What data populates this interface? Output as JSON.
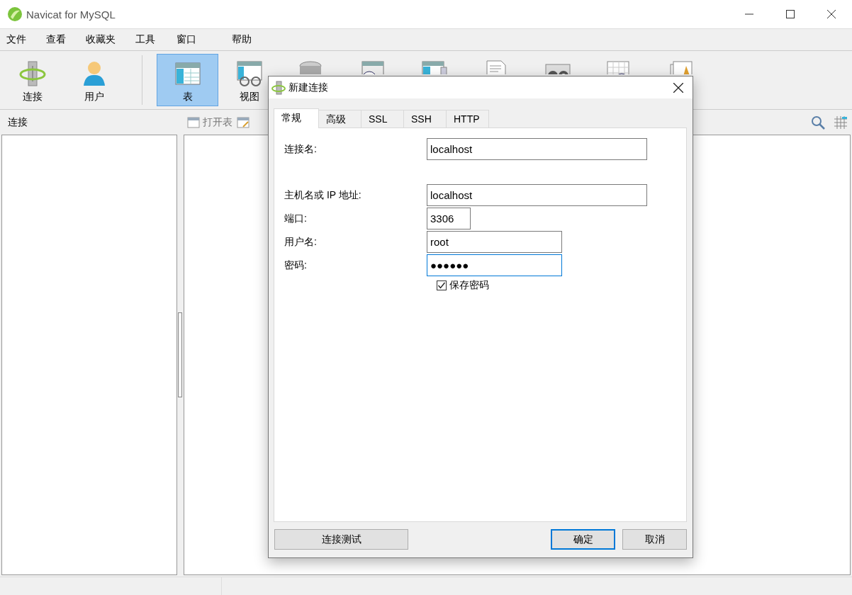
{
  "window": {
    "title": "Navicat for MySQL"
  },
  "menu": [
    "文件",
    "查看",
    "收藏夹",
    "工具",
    "窗口",
    "帮助"
  ],
  "toolbar": [
    {
      "label": "连接",
      "selected": false
    },
    {
      "label": "用户",
      "selected": false
    },
    {
      "label": "表",
      "selected": true
    },
    {
      "label": "视图",
      "selected": false
    },
    {
      "selected": false
    },
    {
      "selected": false
    },
    {
      "selected": false
    },
    {
      "selected": false
    },
    {
      "selected": false
    },
    {
      "selected": false
    },
    {
      "selected": false
    }
  ],
  "sidebar": {
    "title": "连接"
  },
  "object_toolbar": [
    "打开表"
  ],
  "dialog": {
    "title": "新建连接",
    "tabs": [
      {
        "label": "常规",
        "selected": true
      },
      {
        "label": "高级",
        "selected": false
      },
      {
        "label": "SSL",
        "selected": false
      },
      {
        "label": "SSH",
        "selected": false
      },
      {
        "label": "HTTP",
        "selected": false
      }
    ],
    "fields": [
      {
        "label": "连接名:",
        "value": "localhost",
        "focused": false
      },
      {
        "label": "主机名或 IP 地址:",
        "value": "localhost",
        "focused": false
      },
      {
        "label": "端口:",
        "value": "3306",
        "focused": false
      },
      {
        "label": "用户名:",
        "value": "root",
        "focused": false
      },
      {
        "label": "密码:",
        "value": "●●●●●●",
        "focused": true
      }
    ],
    "save_password": {
      "label": "保存密码",
      "checked": true
    },
    "buttons": [
      {
        "label": "连接测试",
        "default": false
      },
      {
        "label": "确定",
        "default": true
      },
      {
        "label": "取消",
        "default": false
      }
    ]
  }
}
